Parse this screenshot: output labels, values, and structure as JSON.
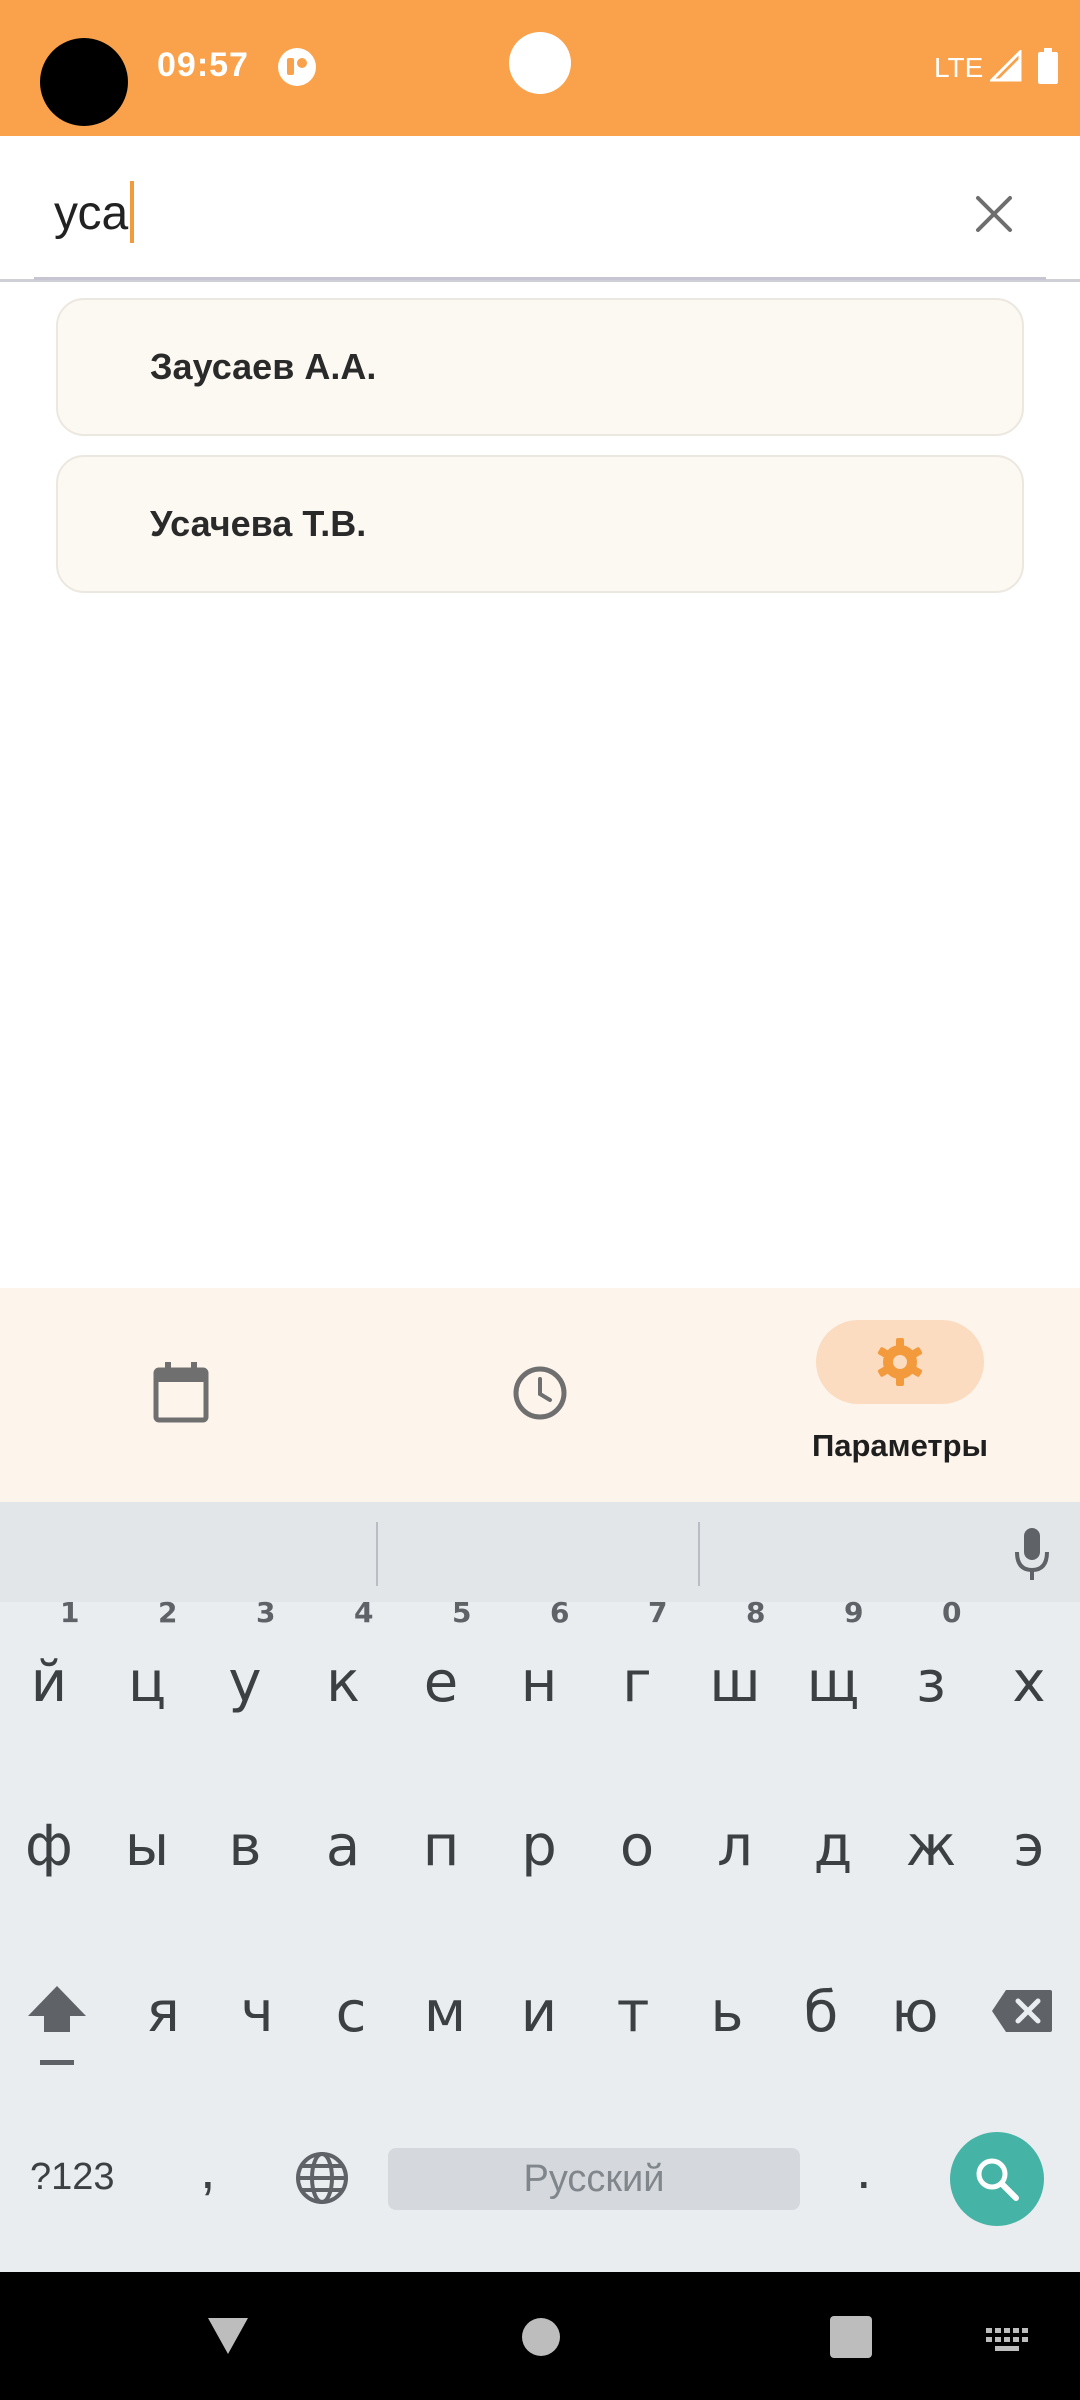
{
  "status_bar": {
    "time": "09:57",
    "network": "LTE",
    "background_color": "#f9a24b"
  },
  "search": {
    "value": "уса",
    "clear_icon": "close-icon"
  },
  "results": [
    {
      "label": "Заусаев А.А."
    },
    {
      "label": "Усачева Т.В."
    }
  ],
  "bottom_nav": {
    "items": [
      {
        "icon": "calendar-icon",
        "label": ""
      },
      {
        "icon": "clock-icon",
        "label": ""
      },
      {
        "icon": "gear-icon",
        "label": "Параметры",
        "active": true
      }
    ],
    "accent_color": "#f39a3d"
  },
  "keyboard": {
    "row1": [
      {
        "key": "й",
        "num": "1"
      },
      {
        "key": "ц",
        "num": "2"
      },
      {
        "key": "у",
        "num": "3"
      },
      {
        "key": "к",
        "num": "4"
      },
      {
        "key": "е",
        "num": "5"
      },
      {
        "key": "н",
        "num": "6"
      },
      {
        "key": "г",
        "num": "7"
      },
      {
        "key": "ш",
        "num": "8"
      },
      {
        "key": "щ",
        "num": "9"
      },
      {
        "key": "з",
        "num": "0"
      },
      {
        "key": "х",
        "num": ""
      }
    ],
    "row2": [
      "ф",
      "ы",
      "в",
      "а",
      "п",
      "р",
      "о",
      "л",
      "д",
      "ж",
      "э"
    ],
    "row3": [
      "я",
      "ч",
      "с",
      "м",
      "и",
      "т",
      "ь",
      "б",
      "ю"
    ],
    "symbols_label": "?123",
    "comma": ",",
    "space_label": "Русский",
    "period": ".",
    "action_color": "#45b3a5"
  }
}
